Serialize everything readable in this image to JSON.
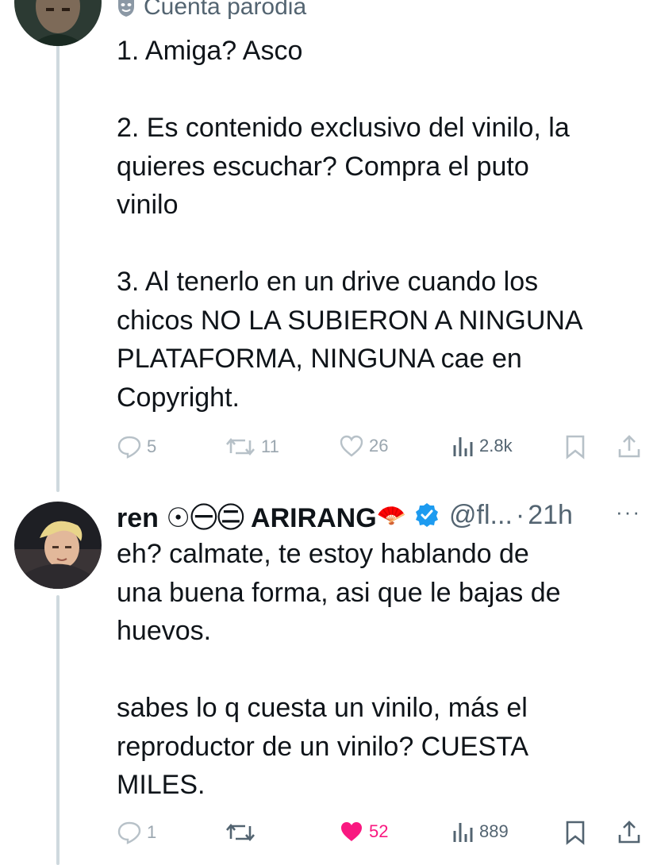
{
  "tweet1": {
    "parody_label": "Cuenta parodia",
    "paragraphs": [
      [
        "1. Amiga? Asco"
      ],
      [
        "2. Es contenido exclusivo del vinilo, la",
        "quieres escuchar? Compra el puto",
        "vinilo"
      ],
      [
        "3. Al tenerlo en un drive cuando los",
        "chicos NO LA SUBIERON A NINGUNA",
        "PLATAFORMA, NINGUNA cae en",
        "Copyright."
      ]
    ],
    "actions": {
      "replies": "5",
      "reposts": "11",
      "likes": "26",
      "views": "2.8k"
    }
  },
  "tweet2": {
    "display_name": "ren ☉㊀㊁ ARIRANG",
    "name_emoji": "🪭",
    "verified_icon": "verified-badge-icon",
    "handle": "@fl...",
    "separator": "·",
    "time": "21h",
    "more_label": "···",
    "paragraphs": [
      [
        "eh? calmate, te estoy hablando de",
        "una buena forma, asi que le bajas de",
        "huevos."
      ],
      [
        "sabes lo q cuesta un vinilo, más el",
        "reproductor de un vinilo? CUESTA",
        "MILES."
      ]
    ],
    "actions": {
      "replies": "1",
      "reposts": "",
      "likes": "52",
      "views": "889",
      "liked": true
    }
  },
  "colors": {
    "text": "#0f1419",
    "muted": "#536471",
    "faded": "#9aa6af",
    "like": "#f91880",
    "verified": "#1d9bf0",
    "thread_line": "#cfd9de"
  }
}
